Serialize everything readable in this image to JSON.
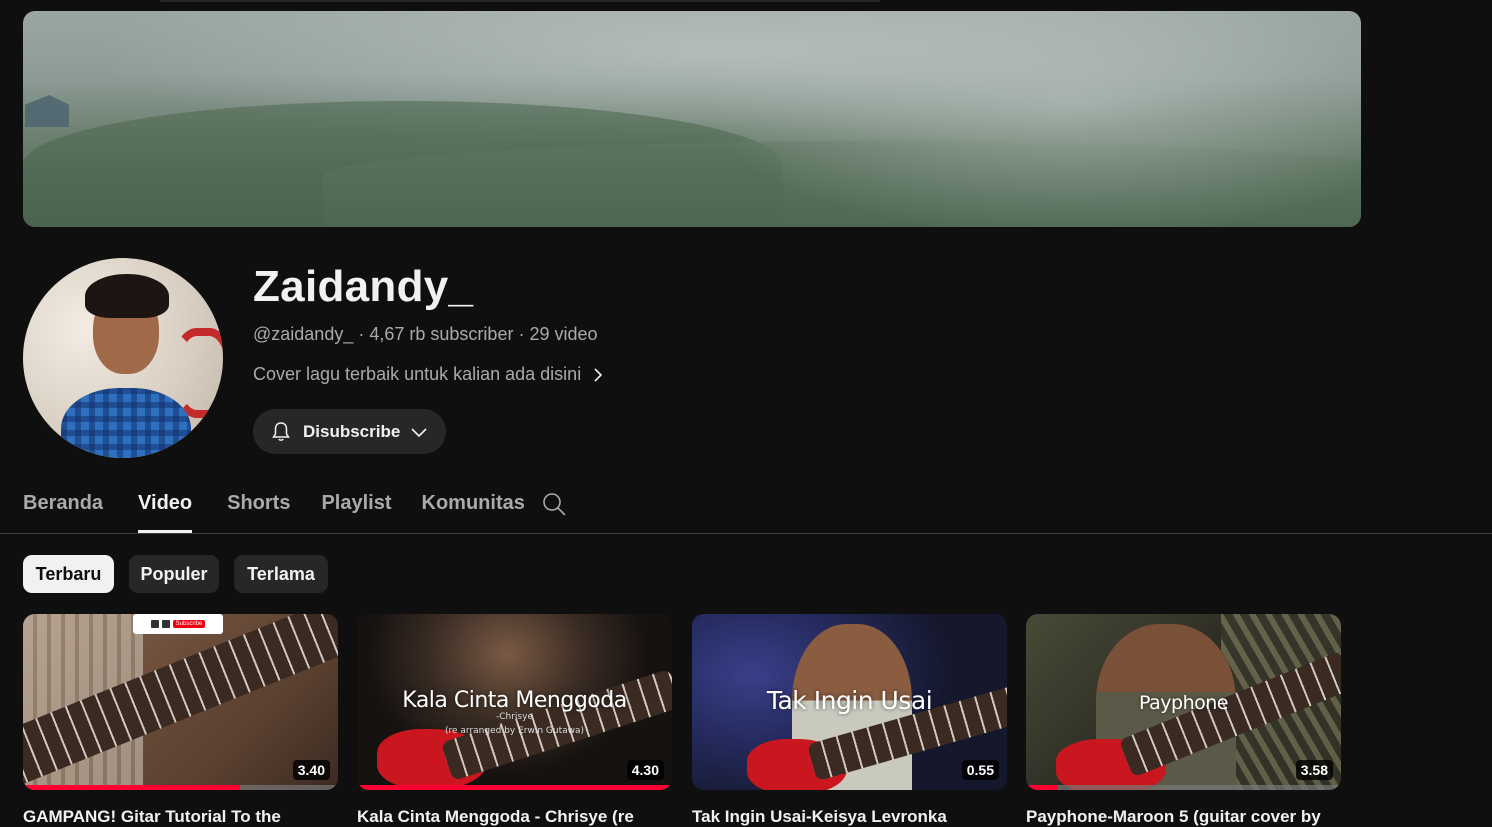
{
  "channel": {
    "name": "Zaidandy_",
    "handle": "@zaidandy_",
    "meta_sep1": "·",
    "subscribers": "4,67 rb subscriber",
    "meta_sep2": "·",
    "video_count": "29 video",
    "description": "Cover lagu terbaik untuk kalian ada disini",
    "subscribe_label": "Disubscribe"
  },
  "tabs": [
    {
      "label": "Beranda",
      "active": false
    },
    {
      "label": "Video",
      "active": true
    },
    {
      "label": "Shorts",
      "active": false
    },
    {
      "label": "Playlist",
      "active": false
    },
    {
      "label": "Komunitas",
      "active": false
    }
  ],
  "filters": [
    {
      "label": "Terbaru",
      "active": true
    },
    {
      "label": "Populer",
      "active": false
    },
    {
      "label": "Terlama",
      "active": false
    }
  ],
  "videos": [
    {
      "title": "GAMPANG! Gitar Tutorial To the",
      "duration": "3.40",
      "watched_fraction": 0.69,
      "overlay_title": "",
      "overlay_sub": "",
      "overlay_sub2": "",
      "sticker": "Subscribe"
    },
    {
      "title": "Kala Cinta Menggoda - Chrisye (re",
      "duration": "4.30",
      "watched_fraction": 1.0,
      "overlay_title": "Kala Cinta Menggoda",
      "overlay_sub": "-Chrisye",
      "overlay_sub2": "(re arranged by Erwin Gutawa)"
    },
    {
      "title": "Tak Ingin Usai-Keisya Levronka",
      "duration": "0.55",
      "watched_fraction": 0.0,
      "overlay_title": "Tak Ingin Usai",
      "overlay_sub": "",
      "overlay_sub2": ""
    },
    {
      "title": "Payphone-Maroon 5 (guitar cover by",
      "duration": "3.58",
      "watched_fraction": 0.1,
      "overlay_title": "Payphone",
      "overlay_sub": "",
      "overlay_sub2": ""
    }
  ],
  "icons": {
    "bell": "bell-icon",
    "chevron_down": "chevron-down-icon",
    "chevron_right": "chevron-right-icon",
    "search": "search-icon"
  },
  "colors": {
    "background": "#0f0f0f",
    "chip": "#272727",
    "progress": "#ff0033"
  }
}
